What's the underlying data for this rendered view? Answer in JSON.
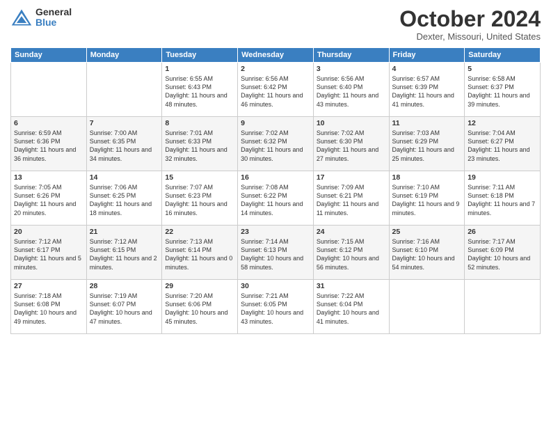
{
  "logo": {
    "general": "General",
    "blue": "Blue"
  },
  "header": {
    "title": "October 2024",
    "location": "Dexter, Missouri, United States"
  },
  "columns": [
    "Sunday",
    "Monday",
    "Tuesday",
    "Wednesday",
    "Thursday",
    "Friday",
    "Saturday"
  ],
  "weeks": [
    [
      {
        "day": "",
        "sunrise": "",
        "sunset": "",
        "daylight": ""
      },
      {
        "day": "",
        "sunrise": "",
        "sunset": "",
        "daylight": ""
      },
      {
        "day": "1",
        "sunrise": "Sunrise: 6:55 AM",
        "sunset": "Sunset: 6:43 PM",
        "daylight": "Daylight: 11 hours and 48 minutes."
      },
      {
        "day": "2",
        "sunrise": "Sunrise: 6:56 AM",
        "sunset": "Sunset: 6:42 PM",
        "daylight": "Daylight: 11 hours and 46 minutes."
      },
      {
        "day": "3",
        "sunrise": "Sunrise: 6:56 AM",
        "sunset": "Sunset: 6:40 PM",
        "daylight": "Daylight: 11 hours and 43 minutes."
      },
      {
        "day": "4",
        "sunrise": "Sunrise: 6:57 AM",
        "sunset": "Sunset: 6:39 PM",
        "daylight": "Daylight: 11 hours and 41 minutes."
      },
      {
        "day": "5",
        "sunrise": "Sunrise: 6:58 AM",
        "sunset": "Sunset: 6:37 PM",
        "daylight": "Daylight: 11 hours and 39 minutes."
      }
    ],
    [
      {
        "day": "6",
        "sunrise": "Sunrise: 6:59 AM",
        "sunset": "Sunset: 6:36 PM",
        "daylight": "Daylight: 11 hours and 36 minutes."
      },
      {
        "day": "7",
        "sunrise": "Sunrise: 7:00 AM",
        "sunset": "Sunset: 6:35 PM",
        "daylight": "Daylight: 11 hours and 34 minutes."
      },
      {
        "day": "8",
        "sunrise": "Sunrise: 7:01 AM",
        "sunset": "Sunset: 6:33 PM",
        "daylight": "Daylight: 11 hours and 32 minutes."
      },
      {
        "day": "9",
        "sunrise": "Sunrise: 7:02 AM",
        "sunset": "Sunset: 6:32 PM",
        "daylight": "Daylight: 11 hours and 30 minutes."
      },
      {
        "day": "10",
        "sunrise": "Sunrise: 7:02 AM",
        "sunset": "Sunset: 6:30 PM",
        "daylight": "Daylight: 11 hours and 27 minutes."
      },
      {
        "day": "11",
        "sunrise": "Sunrise: 7:03 AM",
        "sunset": "Sunset: 6:29 PM",
        "daylight": "Daylight: 11 hours and 25 minutes."
      },
      {
        "day": "12",
        "sunrise": "Sunrise: 7:04 AM",
        "sunset": "Sunset: 6:27 PM",
        "daylight": "Daylight: 11 hours and 23 minutes."
      }
    ],
    [
      {
        "day": "13",
        "sunrise": "Sunrise: 7:05 AM",
        "sunset": "Sunset: 6:26 PM",
        "daylight": "Daylight: 11 hours and 20 minutes."
      },
      {
        "day": "14",
        "sunrise": "Sunrise: 7:06 AM",
        "sunset": "Sunset: 6:25 PM",
        "daylight": "Daylight: 11 hours and 18 minutes."
      },
      {
        "day": "15",
        "sunrise": "Sunrise: 7:07 AM",
        "sunset": "Sunset: 6:23 PM",
        "daylight": "Daylight: 11 hours and 16 minutes."
      },
      {
        "day": "16",
        "sunrise": "Sunrise: 7:08 AM",
        "sunset": "Sunset: 6:22 PM",
        "daylight": "Daylight: 11 hours and 14 minutes."
      },
      {
        "day": "17",
        "sunrise": "Sunrise: 7:09 AM",
        "sunset": "Sunset: 6:21 PM",
        "daylight": "Daylight: 11 hours and 11 minutes."
      },
      {
        "day": "18",
        "sunrise": "Sunrise: 7:10 AM",
        "sunset": "Sunset: 6:19 PM",
        "daylight": "Daylight: 11 hours and 9 minutes."
      },
      {
        "day": "19",
        "sunrise": "Sunrise: 7:11 AM",
        "sunset": "Sunset: 6:18 PM",
        "daylight": "Daylight: 11 hours and 7 minutes."
      }
    ],
    [
      {
        "day": "20",
        "sunrise": "Sunrise: 7:12 AM",
        "sunset": "Sunset: 6:17 PM",
        "daylight": "Daylight: 11 hours and 5 minutes."
      },
      {
        "day": "21",
        "sunrise": "Sunrise: 7:12 AM",
        "sunset": "Sunset: 6:15 PM",
        "daylight": "Daylight: 11 hours and 2 minutes."
      },
      {
        "day": "22",
        "sunrise": "Sunrise: 7:13 AM",
        "sunset": "Sunset: 6:14 PM",
        "daylight": "Daylight: 11 hours and 0 minutes."
      },
      {
        "day": "23",
        "sunrise": "Sunrise: 7:14 AM",
        "sunset": "Sunset: 6:13 PM",
        "daylight": "Daylight: 10 hours and 58 minutes."
      },
      {
        "day": "24",
        "sunrise": "Sunrise: 7:15 AM",
        "sunset": "Sunset: 6:12 PM",
        "daylight": "Daylight: 10 hours and 56 minutes."
      },
      {
        "day": "25",
        "sunrise": "Sunrise: 7:16 AM",
        "sunset": "Sunset: 6:10 PM",
        "daylight": "Daylight: 10 hours and 54 minutes."
      },
      {
        "day": "26",
        "sunrise": "Sunrise: 7:17 AM",
        "sunset": "Sunset: 6:09 PM",
        "daylight": "Daylight: 10 hours and 52 minutes."
      }
    ],
    [
      {
        "day": "27",
        "sunrise": "Sunrise: 7:18 AM",
        "sunset": "Sunset: 6:08 PM",
        "daylight": "Daylight: 10 hours and 49 minutes."
      },
      {
        "day": "28",
        "sunrise": "Sunrise: 7:19 AM",
        "sunset": "Sunset: 6:07 PM",
        "daylight": "Daylight: 10 hours and 47 minutes."
      },
      {
        "day": "29",
        "sunrise": "Sunrise: 7:20 AM",
        "sunset": "Sunset: 6:06 PM",
        "daylight": "Daylight: 10 hours and 45 minutes."
      },
      {
        "day": "30",
        "sunrise": "Sunrise: 7:21 AM",
        "sunset": "Sunset: 6:05 PM",
        "daylight": "Daylight: 10 hours and 43 minutes."
      },
      {
        "day": "31",
        "sunrise": "Sunrise: 7:22 AM",
        "sunset": "Sunset: 6:04 PM",
        "daylight": "Daylight: 10 hours and 41 minutes."
      },
      {
        "day": "",
        "sunrise": "",
        "sunset": "",
        "daylight": ""
      },
      {
        "day": "",
        "sunrise": "",
        "sunset": "",
        "daylight": ""
      }
    ]
  ]
}
